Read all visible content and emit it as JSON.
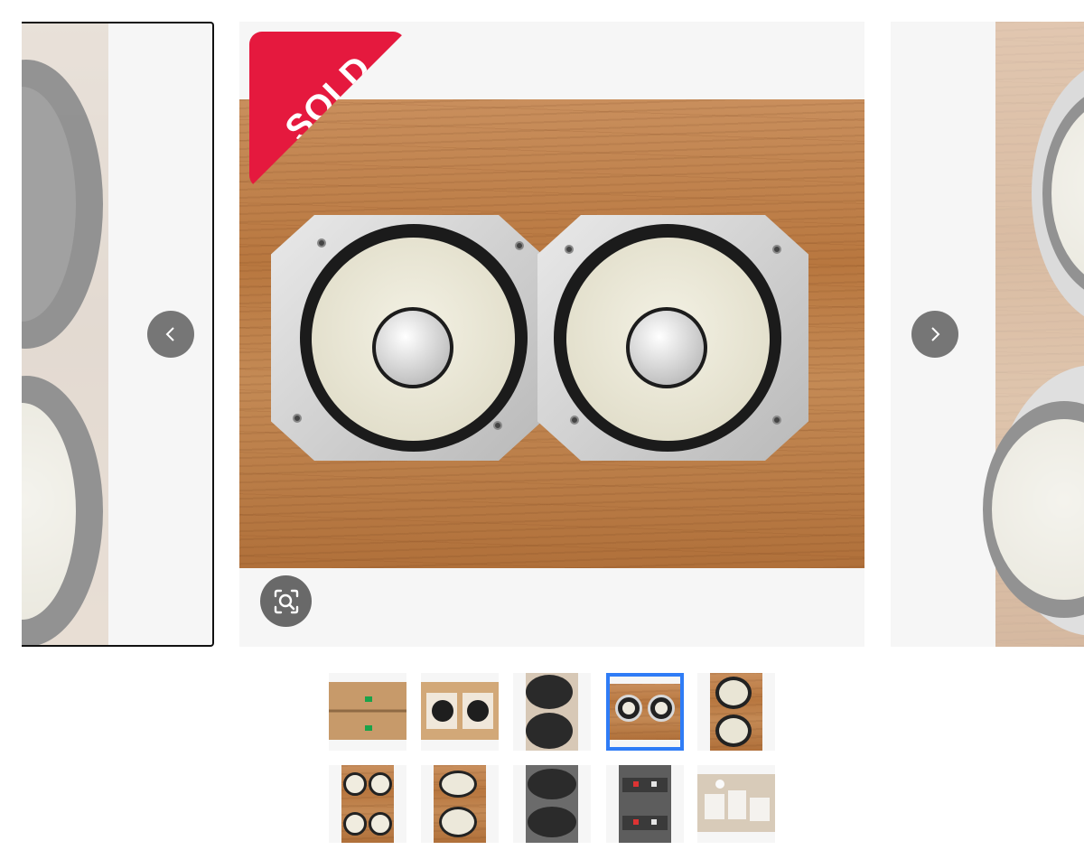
{
  "badge": {
    "text": "SOLD",
    "color": "#e5193e"
  },
  "navigation": {
    "previous_icon": "chevron-left-icon",
    "next_icon": "chevron-right-icon",
    "zoom_icon": "zoom-search-icon"
  },
  "gallery": {
    "selected_index": 4,
    "thumbnail_count": 10,
    "selected_border_color": "#2f7cf6",
    "thumbnails": [
      "boxes-closed",
      "boxes-open",
      "speakers-back-stacked",
      "speakers-pair-front",
      "speakers-front-stacked",
      "speakers-top-view",
      "speaker-angled",
      "speakers-terminals",
      "speakers-terminals-closeup",
      "documents"
    ]
  }
}
